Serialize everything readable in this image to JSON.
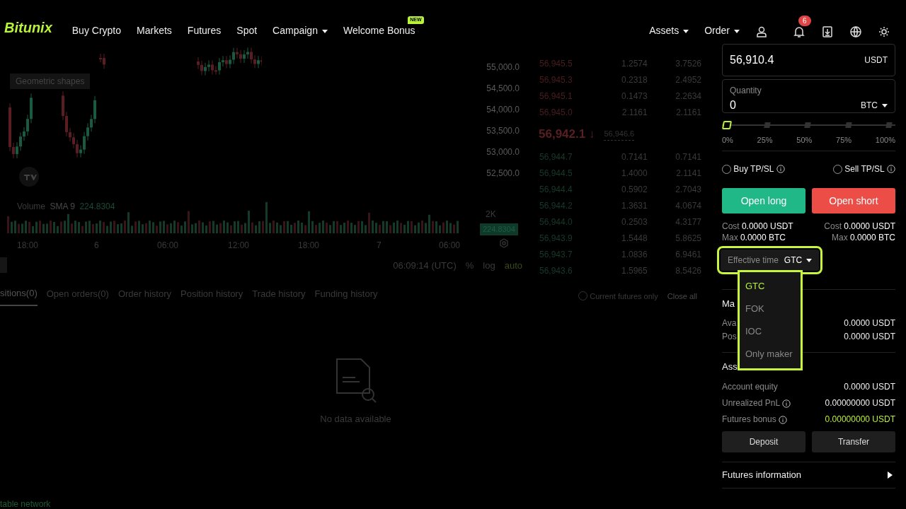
{
  "nav": {
    "logo": "Bitunix",
    "items": [
      {
        "label": "Buy Crypto",
        "dropdown": false
      },
      {
        "label": "Markets",
        "dropdown": false
      },
      {
        "label": "Futures",
        "dropdown": false
      },
      {
        "label": "Spot",
        "dropdown": false
      },
      {
        "label": "Campaign",
        "dropdown": true
      },
      {
        "label": "Welcome Bonus",
        "dropdown": false,
        "badge": "NEW"
      }
    ],
    "right_items": [
      {
        "label": "Assets",
        "dropdown": true
      },
      {
        "label": "Order",
        "dropdown": true
      }
    ],
    "notification_count": "6"
  },
  "chart": {
    "tooltip": "Geometric shapes",
    "price_ticks": [
      "55,000.0",
      "54,500.0",
      "54,000.0",
      "53,500.0",
      "53,000.0",
      "52,500.0"
    ],
    "volume_label": "Volume",
    "sma_label": "SMA 9",
    "sma_value": "224.8304",
    "volume_tick": "2K",
    "volume_tag": "224.8304",
    "time_ticks": [
      "18:00",
      "6",
      "06:00",
      "12:00",
      "18:00",
      "7",
      "06:00"
    ],
    "clock": "06:09:14 (UTC)",
    "scale_buttons": [
      {
        "label": "%",
        "selected": false
      },
      {
        "label": "log",
        "selected": false
      },
      {
        "label": "auto",
        "selected": true
      }
    ]
  },
  "orderbook": {
    "asks": [
      {
        "price": "56,945.5",
        "amount": "1.2574",
        "total": "3.7526"
      },
      {
        "price": "56,945.3",
        "amount": "0.2318",
        "total": "2.4952"
      },
      {
        "price": "56,945.1",
        "amount": "0.1473",
        "total": "2.2634"
      },
      {
        "price": "56,945.0",
        "amount": "2.1161",
        "total": "2.1161"
      }
    ],
    "last_price": "56,942.1",
    "last_arrow": "↓",
    "mark_price": "56,946.6",
    "bids": [
      {
        "price": "56,944.7",
        "amount": "0.7141",
        "total": "0.7141"
      },
      {
        "price": "56,944.5",
        "amount": "1.4000",
        "total": "2.1141"
      },
      {
        "price": "56,944.4",
        "amount": "0.5902",
        "total": "2.7043"
      },
      {
        "price": "56,944.2",
        "amount": "1.3631",
        "total": "4.0674"
      },
      {
        "price": "56,944.0",
        "amount": "0.2503",
        "total": "4.3177"
      },
      {
        "price": "56,943.9",
        "amount": "1.5448",
        "total": "5.8625"
      },
      {
        "price": "56,943.7",
        "amount": "1.0836",
        "total": "6.9461"
      },
      {
        "price": "56,943.6",
        "amount": "1.5965",
        "total": "8.5426"
      }
    ]
  },
  "order_form": {
    "price": {
      "value": "56,910.4",
      "unit": "USDT"
    },
    "quantity": {
      "label": "Quantity",
      "value": "0",
      "unit": "BTC"
    },
    "slider": {
      "level": 0,
      "marks": [
        "0%",
        "25%",
        "50%",
        "75%",
        "100%"
      ]
    },
    "tpsl": [
      {
        "label": "Buy TP/SL",
        "checked": false
      },
      {
        "label": "Sell TP/SL",
        "checked": false
      }
    ],
    "buttons": [
      {
        "label": "Open long",
        "kind": "long"
      },
      {
        "label": "Open short",
        "kind": "short"
      }
    ],
    "costs": [
      [
        {
          "label": "Cost",
          "value": "0.0000 USDT"
        },
        {
          "label": "Max",
          "value": "0.0000 BTC"
        }
      ],
      [
        {
          "label": "Cost",
          "value": "0.0000 USDT"
        },
        {
          "label": "Max",
          "value": "0.0000 BTC"
        }
      ]
    ],
    "effective_time": {
      "label": "Effective time",
      "value": "GTC",
      "highlighted": true
    },
    "options": [
      {
        "label": "GTC",
        "selected": true
      },
      {
        "label": "FOK",
        "selected": false
      },
      {
        "label": "IOC",
        "selected": false
      },
      {
        "label": "Only maker",
        "selected": false
      }
    ],
    "options_highlighted": true
  },
  "margin": {
    "title": "Ma",
    "rows": [
      {
        "label": "Ava",
        "value": "0.0000 USDT"
      },
      {
        "label": "Pos",
        "value": "0.0000 USDT"
      }
    ]
  },
  "assets": {
    "title": "Ass",
    "rows": [
      {
        "label": "Account equity",
        "value": "0.0000 USDT",
        "info": false,
        "positive": false
      },
      {
        "label": "Unrealized PnL",
        "value": "0.00000000 USDT",
        "info": true,
        "positive": false
      },
      {
        "label": "Futures bonus",
        "value": "0.00000000 USDT",
        "info": true,
        "positive": true
      }
    ],
    "buttons": [
      "Deposit",
      "Transfer"
    ]
  },
  "futures_info": "Futures information",
  "bottom": {
    "tabs": [
      {
        "label": "sitions(0)",
        "selected": true
      },
      {
        "label": "Open orders(0)",
        "selected": false
      },
      {
        "label": "Order history",
        "selected": false
      },
      {
        "label": "Position history",
        "selected": false
      },
      {
        "label": "Trade history",
        "selected": false
      },
      {
        "label": "Funding history",
        "selected": false
      }
    ],
    "filter": {
      "label": "Current futures only",
      "checked": false
    },
    "close_all": "Close all",
    "empty": "No data available"
  },
  "status": "table network"
}
